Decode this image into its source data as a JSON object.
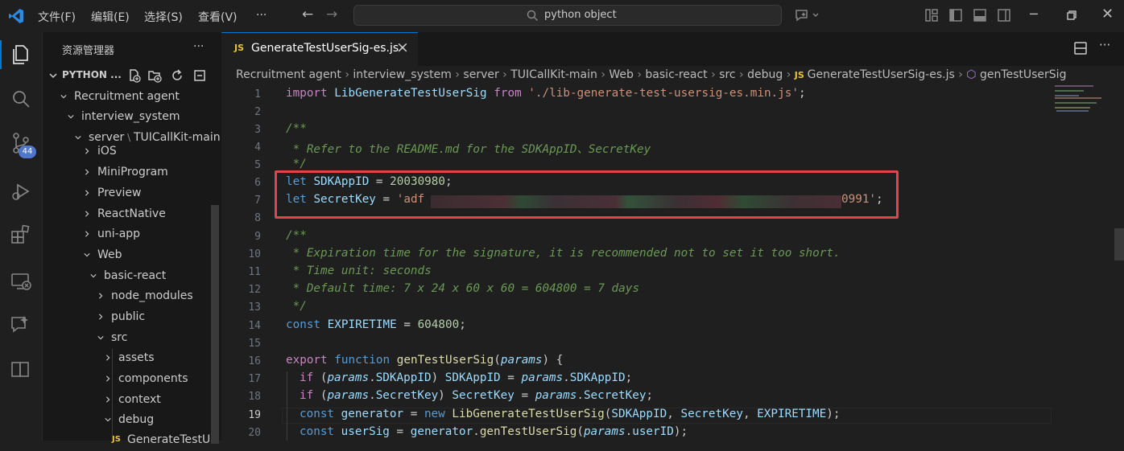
{
  "titlebar": {
    "menus": [
      "文件(F)",
      "编辑(E)",
      "选择(S)",
      "查看(V)",
      "···"
    ],
    "search_text": "python object"
  },
  "activitybar": {
    "badge_count": "44"
  },
  "sidebar": {
    "title": "资源管理器",
    "more": "···",
    "section": "PYTHON ...",
    "tree": [
      {
        "label": "Recruitment agent",
        "expanded": true
      },
      {
        "label": "interview_system",
        "expanded": true
      },
      {
        "label": "server",
        "sep": "\\",
        "label2": "TUICallKit-main",
        "expanded": true
      },
      {
        "label": "iOS",
        "expanded": false
      },
      {
        "label": "MiniProgram",
        "expanded": false
      },
      {
        "label": "Preview",
        "expanded": false
      },
      {
        "label": "ReactNative",
        "expanded": false
      },
      {
        "label": "uni-app",
        "expanded": false
      },
      {
        "label": "Web",
        "expanded": true
      },
      {
        "label": "basic-react",
        "expanded": true
      },
      {
        "label": "node_modules",
        "expanded": false
      },
      {
        "label": "public",
        "expanded": false
      },
      {
        "label": "src",
        "expanded": true
      },
      {
        "label": "assets",
        "expanded": false
      },
      {
        "label": "components",
        "expanded": false
      },
      {
        "label": "context",
        "expanded": false
      },
      {
        "label": "debug",
        "expanded": true
      },
      {
        "label": "GenerateTestUs",
        "icon": "JS"
      }
    ]
  },
  "editor": {
    "tab": {
      "icon": "JS",
      "label": "GenerateTestUserSig-es.js",
      "close": "×"
    },
    "breadcrumb": [
      "Recruitment agent",
      "interview_system",
      "server",
      "TUICallKit-main",
      "Web",
      "basic-react",
      "src",
      "debug"
    ],
    "breadcrumb_file": "GenerateTestUserSig-es.js",
    "breadcrumb_file_icon": "JS",
    "breadcrumb_symbol": "genTestUserSig",
    "line_numbers": [
      "1",
      "2",
      "3",
      "4",
      "5",
      "6",
      "7",
      "8",
      "9",
      "10",
      "11",
      "12",
      "13",
      "14",
      "15",
      "16",
      "17",
      "18",
      "19",
      "20"
    ],
    "current_line": "19",
    "code": {
      "l1": {
        "kw": "import",
        "id": "LibGenerateTestUserSig",
        "from": "from",
        "str": "'./lib-generate-test-usersig-es.min.js'",
        "end": ";"
      },
      "l3": "/**",
      "l4": " * Refer to the README.md for the SDKAppID、SecretKey",
      "l5": " */",
      "l6": {
        "kw": "let",
        "id": "SDKAppID",
        "eq": "=",
        "num": "20030980",
        "end": ";"
      },
      "l7": {
        "kw": "let",
        "id": "SecretKey",
        "eq": "=",
        "str_start": "'adf",
        "str_end": "0991'",
        "end": ";"
      },
      "l9": "/**",
      "l10": " * Expiration time for the signature, it is recommended not to set it too short.",
      "l11": " * Time unit: seconds",
      "l12": " * Default time: 7 x 24 x 60 x 60 = 604800 = 7 days",
      "l13": " */",
      "l14": {
        "kw": "const",
        "id": "EXPIRETIME",
        "eq": "=",
        "num": "604800",
        "end": ";"
      },
      "l16": {
        "kw1": "export",
        "kw2": "function",
        "fn": "genTestUserSig",
        "open": "(",
        "param": "params",
        "close": ") {"
      },
      "l17": {
        "kw": "if",
        "p1": "(",
        "param": "params",
        "dot": ".",
        "prop": "SDKAppID",
        "p2": ")",
        "id": "SDKAppID",
        "eq": "=",
        "param2": "params",
        "prop2": "SDKAppID",
        "end": ";"
      },
      "l18": {
        "kw": "if",
        "p1": "(",
        "param": "params",
        "dot": ".",
        "prop": "SecretKey",
        "p2": ")",
        "id": "SecretKey",
        "eq": "=",
        "param2": "params",
        "prop2": "SecretKey",
        "end": ";"
      },
      "l19": {
        "kw": "const",
        "id": "generator",
        "eq": "=",
        "new": "new",
        "cls": "LibGenerateTestUserSig",
        "args_open": "(",
        "a1": "SDKAppID",
        "a2": "SecretKey",
        "a3": "EXPIRETIME",
        "args_close": ");"
      },
      "l20": {
        "kw": "const",
        "id": "userSig",
        "eq": "=",
        "obj": "generator",
        "fn": "genTestUserSig",
        "open": "(",
        "param": "params",
        "prop": "userID",
        "close": ");"
      }
    }
  },
  "colors": {
    "accent": "#0078d4",
    "highlight_box": "#e0454a",
    "badge": "#4d78cc"
  }
}
